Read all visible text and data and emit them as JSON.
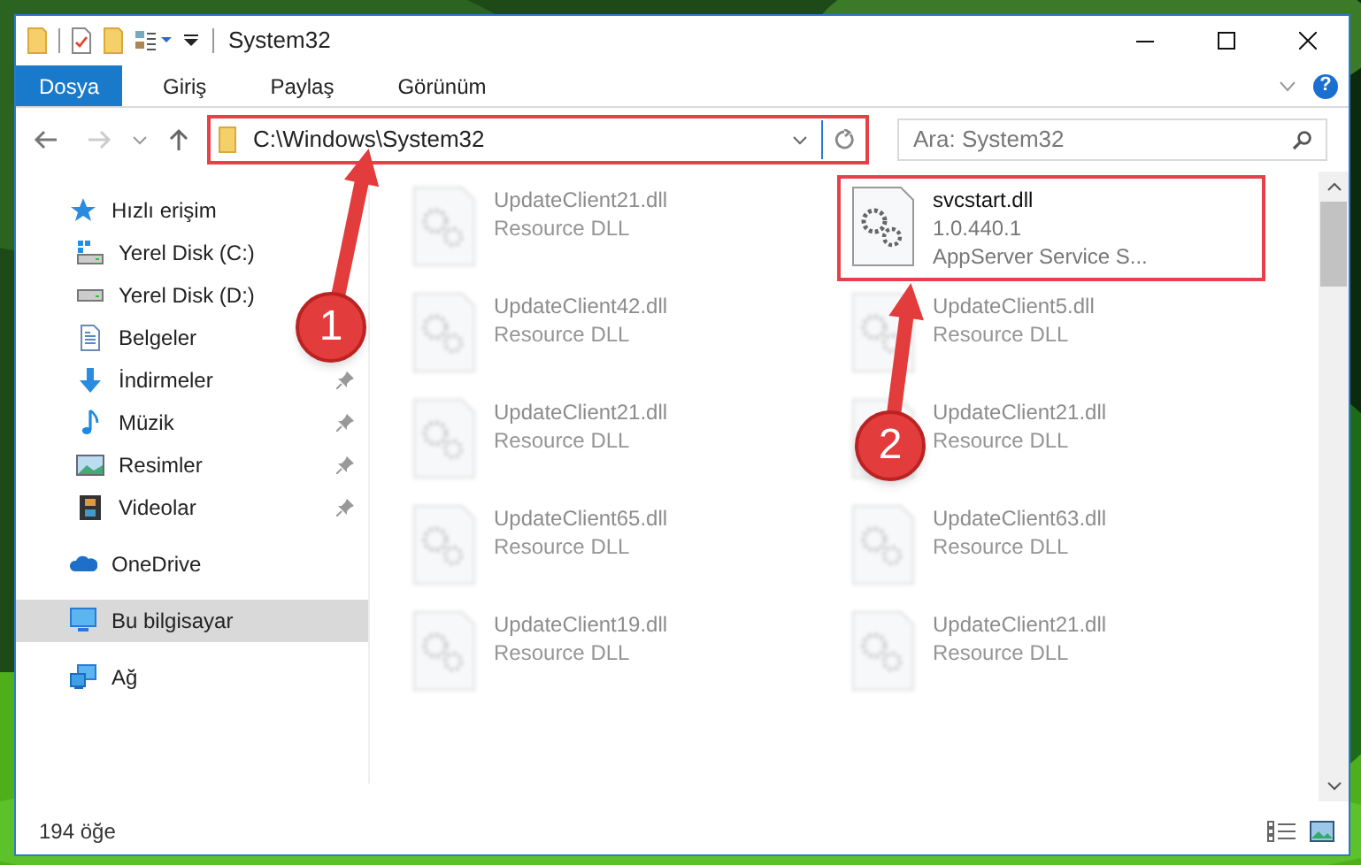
{
  "window": {
    "title": "System32"
  },
  "ribbon_tabs": [
    {
      "label": "Dosya",
      "selected": true
    },
    {
      "label": "Giriş",
      "selected": false
    },
    {
      "label": "Paylaş",
      "selected": false
    },
    {
      "label": "Görünüm",
      "selected": false
    }
  ],
  "help": "?",
  "address": {
    "path": "C:\\Windows\\System32",
    "highlighted": true
  },
  "search": {
    "placeholder": "Ara: System32"
  },
  "sidebar": {
    "items": [
      {
        "label": "Hızlı erişim",
        "kind": "star",
        "pinned": false,
        "selected": false,
        "children": [
          {
            "label": "Yerel Disk (C:)",
            "kind": "drive-win",
            "pinned": false,
            "selected": false
          },
          {
            "label": "Yerel Disk (D:)",
            "kind": "drive",
            "pinned": false,
            "selected": false
          },
          {
            "label": "Belgeler",
            "kind": "document",
            "pinned": false,
            "selected": false
          },
          {
            "label": "İndirmeler",
            "kind": "download",
            "pinned": true,
            "selected": false
          },
          {
            "label": "Müzik",
            "kind": "music",
            "pinned": true,
            "selected": false
          },
          {
            "label": "Resimler",
            "kind": "pictures",
            "pinned": true,
            "selected": false
          },
          {
            "label": "Videolar",
            "kind": "video",
            "pinned": true,
            "selected": false
          }
        ]
      },
      {
        "label": "OneDrive",
        "kind": "cloud",
        "pinned": false,
        "selected": false
      },
      {
        "label": "Bu bilgisayar",
        "kind": "pc",
        "pinned": false,
        "selected": true
      },
      {
        "label": "Ağ",
        "kind": "network",
        "pinned": false,
        "selected": false
      }
    ]
  },
  "files": [
    {
      "name": "UpdateClient21.dll",
      "lines": [
        "Resource DLL"
      ],
      "blurred": true,
      "highlighted": false
    },
    {
      "name": "svcstart.dll",
      "lines": [
        "1.0.440.1",
        "AppServer Service S..."
      ],
      "blurred": false,
      "highlighted": true
    },
    {
      "name": "UpdateClient42.dll",
      "lines": [
        "Resource DLL"
      ],
      "blurred": true,
      "highlighted": false
    },
    {
      "name": "UpdateClient5.dll",
      "lines": [
        "Resource DLL"
      ],
      "blurred": true,
      "highlighted": false
    },
    {
      "name": "UpdateClient21.dll",
      "lines": [
        "Resource DLL"
      ],
      "blurred": true,
      "highlighted": false
    },
    {
      "name": "UpdateClient21.dll",
      "lines": [
        "Resource DLL"
      ],
      "blurred": true,
      "highlighted": false
    },
    {
      "name": "UpdateClient65.dll",
      "lines": [
        "Resource DLL"
      ],
      "blurred": true,
      "highlighted": false
    },
    {
      "name": "UpdateClient63.dll",
      "lines": [
        "Resource DLL"
      ],
      "blurred": true,
      "highlighted": false
    },
    {
      "name": "UpdateClient19.dll",
      "lines": [
        "Resource DLL"
      ],
      "blurred": true,
      "highlighted": false
    },
    {
      "name": "UpdateClient21.dll",
      "lines": [
        "Resource DLL"
      ],
      "blurred": true,
      "highlighted": false
    }
  ],
  "status_bar": {
    "count": "194 öğe"
  },
  "annotations": [
    {
      "label": "1"
    },
    {
      "label": "2"
    }
  ]
}
